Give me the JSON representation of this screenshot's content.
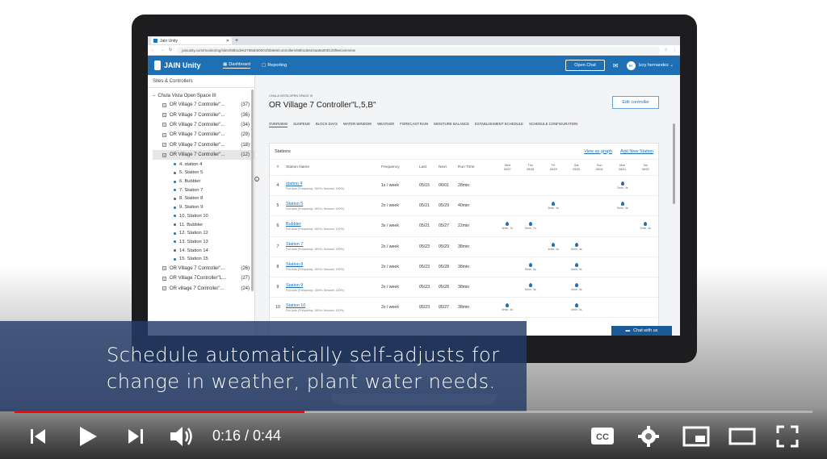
{
  "browser": {
    "tab_title": "Jain Unity",
    "url": "jainunity.com/monitoring/sites/59b1de62799ab50001f6b8e5/controllers/59b1de624aa9a000126f9e/overview"
  },
  "app": {
    "brand": "JAIN Unity",
    "nav": [
      "Dashboard",
      "Reporting"
    ],
    "open_chat": "Open Chat",
    "user_initials": "IH",
    "user_name": "Izzy hernandez"
  },
  "sidebar": {
    "header": "Sites & Controllers",
    "site": "Chula Vista Open Space III",
    "controllers_top": [
      {
        "name": "OR Village 7 Controller\"...",
        "count": "(37)"
      },
      {
        "name": "OR Village 7 Controller\"...",
        "count": "(36)"
      },
      {
        "name": "OR Village 7 Controller\"...",
        "count": "(34)"
      },
      {
        "name": "OR Village 7 Controller\"...",
        "count": "(29)"
      },
      {
        "name": "OR Village 7 Controller\"...",
        "count": "(18)"
      },
      {
        "name": "OR Village 7 Controller\"...",
        "count": "(12)"
      }
    ],
    "stations": [
      "4. station 4",
      "5. Station 5",
      "6. Bubbler",
      "7. Station 7",
      "8. Station 8",
      "9. Station 9",
      "10. Station 10",
      "11. Bubbler",
      "12. Station 12",
      "13. Station 13",
      "14. Station 14",
      "15. Station 15"
    ],
    "controllers_bottom": [
      {
        "name": "OR Village 7 Controller\"...",
        "count": "(26)"
      },
      {
        "name": "OR Village 7Controller\"L...",
        "count": "(27)"
      },
      {
        "name": "OR village 7 Controller\"...",
        "count": "(24)"
      }
    ]
  },
  "main": {
    "breadcrumb": "CHULA VISTA OPEN SPACE III",
    "title": "OR Village 7 Controller\"L,5,B\"",
    "edit_button": "Edit controller",
    "subtabs": [
      "OVERVIEW",
      "SUSPEND",
      "BLOCK DAYS",
      "WATER WINDOW",
      "WEATHER",
      "FORECAST RAIN",
      "MOISTURE BALANCE",
      "ESTABLISHMENT SCHEDULE",
      "SCHEDULE CONFIGURATION"
    ],
    "card_title": "Stations",
    "view_graph": "View as graph",
    "add_station": "Add New Station",
    "headers": {
      "num": "#",
      "station": "Station Name",
      "freq": "Frequency",
      "last": "Last",
      "next": "Next",
      "run": "Run Time"
    },
    "days": [
      {
        "d": "Wed",
        "dt": "05/27"
      },
      {
        "d": "Thu",
        "dt": "05/28"
      },
      {
        "d": "Fri",
        "dt": "05/29"
      },
      {
        "d": "Sat",
        "dt": "05/30"
      },
      {
        "d": "Sun",
        "dt": "05/31"
      },
      {
        "d": "Mon",
        "dt": "06/01"
      },
      {
        "d": "Tue",
        "dt": "06/02"
      }
    ],
    "rows": [
      {
        "num": "4",
        "name": "station 4",
        "sub": "Full Auto (Frequency: 100% / Amount: 100%)",
        "freq": "1x / week",
        "last": "05/15",
        "next": "06/01",
        "run": "28min",
        "water": [
          "",
          "",
          "",
          "",
          "",
          "2min, 4s",
          ""
        ]
      },
      {
        "num": "5",
        "name": "Station 5",
        "sub": "Full Auto (Frequency: 100% / Amount: 100%)",
        "freq": "2x / week",
        "last": "05/21",
        "next": "05/29",
        "run": "40min",
        "water": [
          "",
          "",
          "5min, 4s",
          "",
          "",
          "5min, 4s",
          ""
        ]
      },
      {
        "num": "6",
        "name": "Bubbler",
        "sub": "Full Auto (Frequency: 100% / Amount: 100%)",
        "freq": "3x / week",
        "last": "05/21",
        "next": "05/27",
        "run": "22min",
        "water": [
          "5min, 7s",
          "5min, 7s",
          "",
          "",
          "",
          "",
          "2min, 4s"
        ]
      },
      {
        "num": "7",
        "name": "Station 7",
        "sub": "Full Auto (Frequency: 100% / Amount: 100%)",
        "freq": "2x / week",
        "last": "05/23",
        "next": "05/29",
        "run": "38min",
        "water": [
          "",
          "",
          "4min, 3s",
          "5min, 4s",
          "",
          "",
          ""
        ]
      },
      {
        "num": "8",
        "name": "Station 8",
        "sub": "Full Auto (Frequency: 100% / Amount: 100%)",
        "freq": "2x / week",
        "last": "05/23",
        "next": "05/28",
        "run": "38min",
        "water": [
          "",
          "5min, 4s",
          "",
          "4min, 3s",
          "",
          "",
          ""
        ]
      },
      {
        "num": "9",
        "name": "Station 9",
        "sub": "Full Auto (Frequency: 100% / Amount: 100%)",
        "freq": "2x / week",
        "last": "05/23",
        "next": "05/28",
        "run": "38min",
        "water": [
          "",
          "5min, 4s",
          "",
          "4min, 3s",
          "",
          "",
          ""
        ]
      },
      {
        "num": "10",
        "name": "Station 10",
        "sub": "Full Auto (Frequency: 100% / Amount: 100%)",
        "freq": "2x / week",
        "last": "05/23",
        "next": "05/27",
        "run": "38min",
        "water": [
          "5min, 4s",
          "",
          "",
          "4min, 3s",
          "",
          "",
          ""
        ]
      }
    ],
    "chat_widget": "Chat with us"
  },
  "caption": {
    "line1": "Schedule automatically self-adjusts for",
    "line2": "change in weather, plant water needs."
  },
  "player": {
    "time_current": "0:16",
    "time_total": "0:44",
    "time_display": "0:16 / 0:44",
    "progress_fraction": 0.3636,
    "accent": "#ff0000"
  }
}
